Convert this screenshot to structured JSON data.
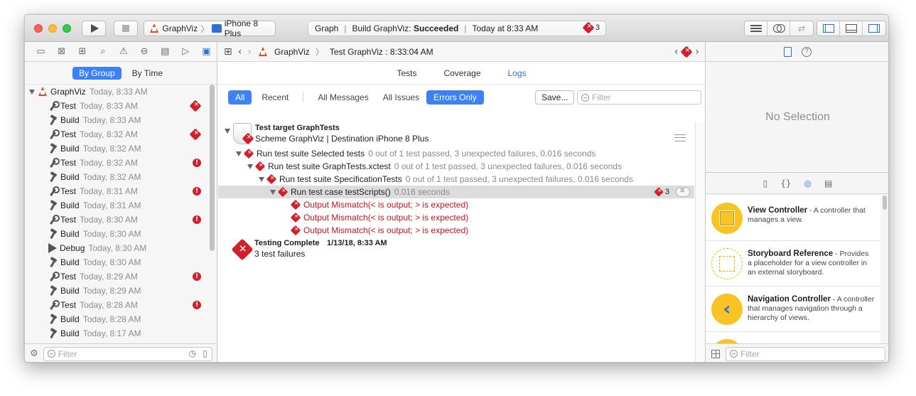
{
  "toolbar": {
    "scheme_app": "GraphViz",
    "scheme_device": "iPhone 8 Plus",
    "activity_project": "Graph",
    "activity_build_prefix": "Build GraphViz:",
    "activity_build_status": "Succeeded",
    "activity_time": "Today at 8:33 AM",
    "activity_error_count": "3"
  },
  "navigator": {
    "group_by_group": "By Group",
    "group_by_time": "By Time",
    "root": {
      "name": "GraphViz",
      "time": "Today, 8:33 AM"
    },
    "items": [
      {
        "kind": "Test",
        "time": "Today, 8:33 AM",
        "badge": "x"
      },
      {
        "kind": "Build",
        "time": "Today, 8:33 AM",
        "badge": ""
      },
      {
        "kind": "Test",
        "time": "Today, 8:32 AM",
        "badge": "x"
      },
      {
        "kind": "Build",
        "time": "Today, 8:32 AM",
        "badge": ""
      },
      {
        "kind": "Test",
        "time": "Today, 8:32 AM",
        "badge": "!"
      },
      {
        "kind": "Build",
        "time": "Today, 8:32 AM",
        "badge": ""
      },
      {
        "kind": "Test",
        "time": "Today, 8:31 AM",
        "badge": "!"
      },
      {
        "kind": "Build",
        "time": "Today, 8:31 AM",
        "badge": ""
      },
      {
        "kind": "Test",
        "time": "Today, 8:30 AM",
        "badge": "!"
      },
      {
        "kind": "Build",
        "time": "Today, 8:30 AM",
        "badge": ""
      },
      {
        "kind": "Debug",
        "time": "Today, 8:30 AM",
        "badge": ""
      },
      {
        "kind": "Build",
        "time": "Today, 8:30 AM",
        "badge": ""
      },
      {
        "kind": "Test",
        "time": "Today, 8:29 AM",
        "badge": "!"
      },
      {
        "kind": "Build",
        "time": "Today, 8:29 AM",
        "badge": ""
      },
      {
        "kind": "Test",
        "time": "Today, 8:28 AM",
        "badge": "!"
      },
      {
        "kind": "Build",
        "time": "Today, 8:28 AM",
        "badge": ""
      },
      {
        "kind": "Build",
        "time": "Today, 8:17 AM",
        "badge": ""
      }
    ],
    "filter_placeholder": "Filter"
  },
  "editor": {
    "breadcrumb_app": "GraphViz",
    "breadcrumb_item": "Test GraphViz : 8:33:04 AM",
    "tabs": [
      "Tests",
      "Coverage",
      "Logs"
    ],
    "filters": {
      "all": "All",
      "recent": "Recent",
      "all_messages": "All Messages",
      "all_issues": "All Issues",
      "errors_only": "Errors Only",
      "save": "Save...",
      "filter_placeholder": "Filter"
    },
    "log": {
      "target_title": "Test target GraphTests",
      "target_subtitle": "Scheme GraphViz | Destination iPhone 8 Plus",
      "suite1": "Run test suite Selected tests",
      "suite1_detail": "0 out of 1 test passed, 3 unexpected failures, 0.016 seconds",
      "suite2": "Run test suite GraphTests.xctest",
      "suite2_detail": "0 out of 1 test passed, 3 unexpected failures, 0.016 seconds",
      "suite3": "Run test suite SpecificationTests",
      "suite3_detail": "0 out of 1 test passed, 3 unexpected failures, 0.016 seconds",
      "case": "Run test case testScripts()",
      "case_detail": "0.016 seconds",
      "case_error_count": "3",
      "errors": [
        "Output Mismatch(< is output; > is expected)",
        "Output Mismatch(< is output; > is expected)",
        "Output Mismatch(< is output; > is expected)"
      ],
      "complete_title": "Testing Complete",
      "complete_date": "1/13/18, 8:33 AM",
      "complete_subtitle": "3 test failures"
    }
  },
  "inspector": {
    "no_selection": "No Selection",
    "library": [
      {
        "title": "View Controller",
        "desc": " - A controller that manages a view."
      },
      {
        "title": "Storyboard Reference",
        "desc": " - Provides a placeholder for a view controller in an external storyboard."
      },
      {
        "title": "Navigation Controller",
        "desc": " - A controller that manages navigation through a hierarchy of views."
      }
    ],
    "filter_placeholder": "Filter"
  }
}
